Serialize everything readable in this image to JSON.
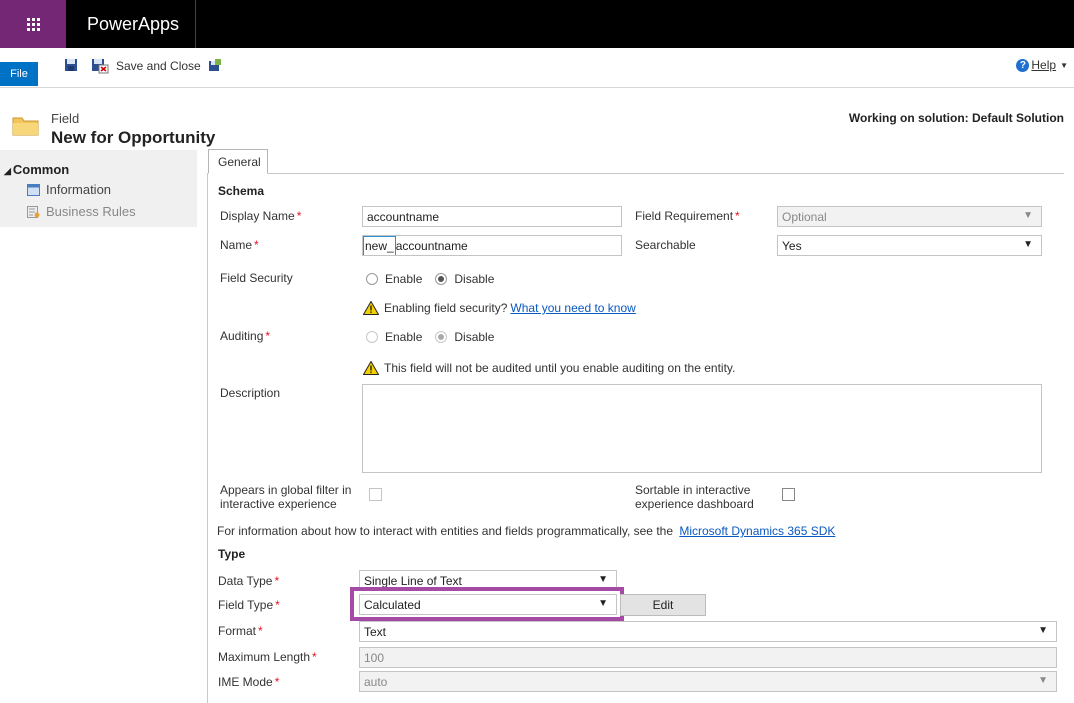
{
  "app": {
    "title": "PowerApps"
  },
  "ribbon": {
    "file_label": "File",
    "save_and_close_label": "Save and Close",
    "help_label": "Help"
  },
  "header": {
    "entity_type": "Field",
    "entity_name": "New for Opportunity",
    "working_on": "Working on solution: Default Solution"
  },
  "sidebar": {
    "group_label": "Common",
    "items": [
      {
        "label": "Information"
      },
      {
        "label": "Business Rules"
      }
    ]
  },
  "tabs": [
    {
      "label": "General"
    }
  ],
  "schema": {
    "heading": "Schema",
    "display_name": {
      "label": "Display Name",
      "value": "accountname"
    },
    "field_requirement": {
      "label": "Field Requirement",
      "value": "Optional"
    },
    "name": {
      "label": "Name",
      "prefix": "new_",
      "value": "accountname"
    },
    "searchable": {
      "label": "Searchable",
      "value": "Yes"
    },
    "field_security": {
      "label": "Field Security",
      "enable": "Enable",
      "disable": "Disable"
    },
    "field_security_warning": {
      "text": "Enabling field security?",
      "link": "What you need to know"
    },
    "auditing": {
      "label": "Auditing",
      "enable": "Enable",
      "disable": "Disable"
    },
    "auditing_warning": "This field will not be audited until you enable auditing on the entity.",
    "description": {
      "label": "Description",
      "value": ""
    },
    "global_filter": {
      "label_line1": "Appears in global filter in",
      "label_line2": "interactive experience"
    },
    "sortable": {
      "label_line1": "Sortable in interactive",
      "label_line2": "experience dashboard"
    },
    "sdk_info": {
      "text": "For information about how to interact with entities and fields programmatically, see the",
      "link": "Microsoft Dynamics 365 SDK"
    }
  },
  "type": {
    "heading": "Type",
    "data_type": {
      "label": "Data Type",
      "value": "Single Line of Text"
    },
    "field_type": {
      "label": "Field Type",
      "value": "Calculated",
      "edit_label": "Edit"
    },
    "format": {
      "label": "Format",
      "value": "Text"
    },
    "max_length": {
      "label": "Maximum Length",
      "value": "100"
    },
    "ime_mode": {
      "label": "IME Mode",
      "value": "auto"
    }
  },
  "colors": {
    "brand": "#742774",
    "file_blue": "#0072c6",
    "highlight": "#a54aa5",
    "required": "#e81123",
    "link": "#0a58c2"
  },
  "icons": [
    "waffle-icon",
    "save-icon",
    "save-and-close-icon",
    "publish-icon",
    "help-icon",
    "folder-icon",
    "form-icon",
    "business-rules-icon",
    "warning-icon"
  ]
}
